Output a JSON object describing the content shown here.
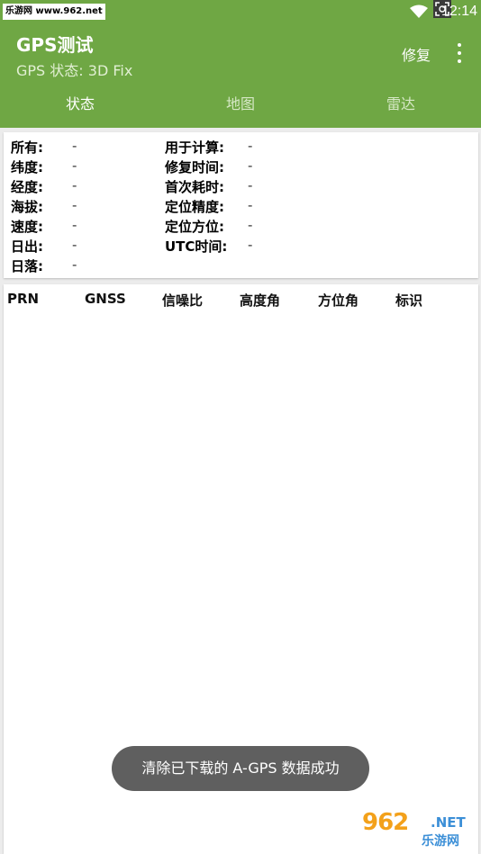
{
  "status_bar": {
    "watermark": "乐游网 www.962.net",
    "time": "12:14"
  },
  "app_bar": {
    "title": "GPS测试",
    "subtitle": "GPS 状态:  3D Fix",
    "action_label": "修复"
  },
  "tabs": [
    {
      "label": "状态",
      "active": true
    },
    {
      "label": "地图",
      "active": false
    },
    {
      "label": "雷达",
      "active": false
    }
  ],
  "status_panel": {
    "left": [
      {
        "label": "所有:",
        "value": "-"
      },
      {
        "label": "纬度:",
        "value": "-"
      },
      {
        "label": "经度:",
        "value": "-"
      },
      {
        "label": "海拔:",
        "value": "-"
      },
      {
        "label": "速度:",
        "value": "-"
      },
      {
        "label": "日出:",
        "value": "-"
      },
      {
        "label": "日落:",
        "value": "-"
      }
    ],
    "right": [
      {
        "label": "用于计算:",
        "value": "-"
      },
      {
        "label": "修复时间:",
        "value": "-"
      },
      {
        "label": "首次耗时:",
        "value": "-"
      },
      {
        "label": "定位精度:",
        "value": "-"
      },
      {
        "label": "定位方位:",
        "value": "-"
      },
      {
        "label": "UTC时间:",
        "value": "-"
      }
    ]
  },
  "satellite_table": {
    "columns": [
      "PRN",
      "GNSS",
      "信噪比",
      "高度角",
      "方位角",
      "标识"
    ],
    "rows": []
  },
  "toast": "清除已下载的 A-GPS 数据成功",
  "watermark_bottom": {
    "logo": "962",
    "net": ".NET",
    "sub": "乐游网"
  },
  "colors": {
    "primary": "#6fa744",
    "background": "#ececec",
    "toast": "#5f5f5f"
  }
}
